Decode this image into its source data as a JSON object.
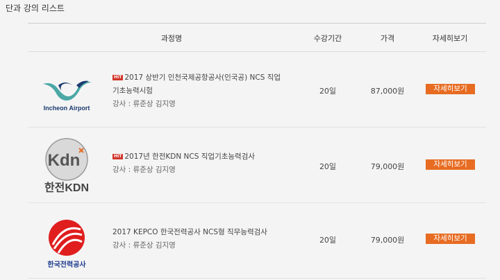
{
  "section_title": "단과 강의 리스트",
  "table_headers": {
    "course": "과정명",
    "period": "수강기간",
    "price": "가격",
    "detail": "자세히보기"
  },
  "hit_badge": "HIT",
  "colors": {
    "accent": "#e76c22",
    "hit_red": "#d0352a",
    "kepco_red": "#e01e1e",
    "incheon_navy": "#1c3b6e",
    "incheon_teal": "#4aa8a6"
  },
  "courses": [
    {
      "logo": "incheon-airport-logo",
      "logo_text": "Incheon Airport",
      "title_line1": "2017 상반기 인천국제공항공사(인국공) NCS 직업",
      "title_line2": "기초능력시험",
      "lecturer": "강사 : 류준상 김지영",
      "period": "20일",
      "price": "87,000원",
      "detail_label": "자세히보기",
      "hit": true
    },
    {
      "logo": "kdn-logo",
      "logo_text": "Kdn",
      "logo_subtext": "한전KDN",
      "title_line1": "2017년 한전KDN NCS 직업기초능력검사",
      "lecturer": "강사 : 류준상 김지영",
      "period": "20일",
      "price": "79,000원",
      "detail_label": "자세히보기",
      "hit": true
    },
    {
      "logo": "kepco-logo",
      "logo_text": "한국전력공사",
      "title_line1": "2017 KEPCO 한국전력공사 NCS형 직무능력검사",
      "lecturer": "강사 : 류준상 김지영",
      "period": "20일",
      "price": "79,000원",
      "detail_label": "자세히보기",
      "hit": false
    }
  ]
}
